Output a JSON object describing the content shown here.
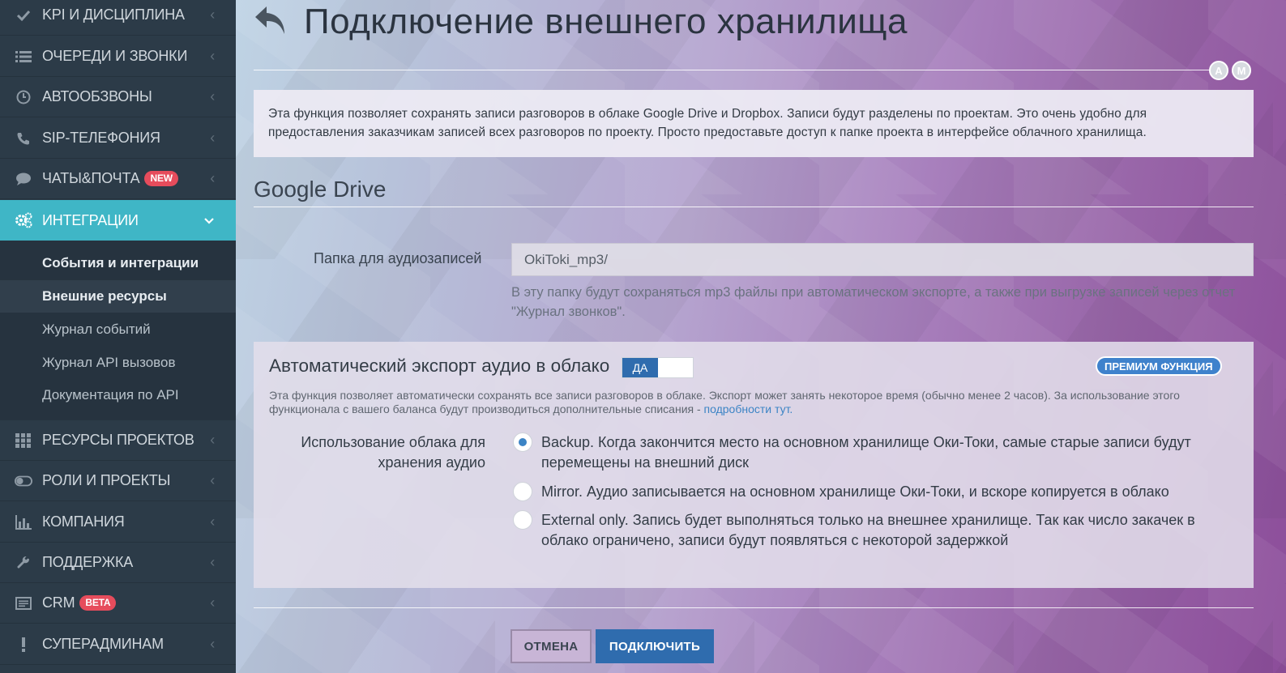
{
  "sidebar": {
    "items": [
      {
        "label": "KPI И ДИСЦИПЛИНА",
        "icon": "check-icon"
      },
      {
        "label": "ОЧЕРЕДИ И ЗВОНКИ",
        "icon": "list-icon"
      },
      {
        "label": "АВТООБЗВОНЫ",
        "icon": "clock-icon"
      },
      {
        "label": "SIP-ТЕЛЕФОНИЯ",
        "icon": "phone-icon"
      },
      {
        "label": "ЧАТЫ&ПОЧТА",
        "icon": "chat-icon",
        "badge": "NEW"
      },
      {
        "label": "ИНТЕГРАЦИИ",
        "icon": "gears-icon"
      },
      {
        "label": "РЕСУРСЫ ПРОЕКТОВ",
        "icon": "grid-icon"
      },
      {
        "label": "РОЛИ И ПРОЕКТЫ",
        "icon": "toggle-icon"
      },
      {
        "label": "КОМПАНИЯ",
        "icon": "bar-chart-icon"
      },
      {
        "label": "ПОДДЕРЖКА",
        "icon": "wrench-icon"
      },
      {
        "label": "CRM",
        "icon": "card-icon",
        "badge": "BETA"
      },
      {
        "label": "СУПЕРАДМИНАМ",
        "icon": "exclamation-icon"
      }
    ],
    "submenu": [
      {
        "label": "События и интеграции"
      },
      {
        "label": "Внешние ресурсы"
      },
      {
        "label": "Журнал событий"
      },
      {
        "label": "Журнал API вызовов"
      },
      {
        "label": "Документация по API"
      }
    ]
  },
  "header": {
    "title": "Подключение внешнего хранилища",
    "lang_a": "A",
    "lang_m": "M"
  },
  "info": {
    "text": "Эта функция позволяет сохранять записи разговоров в облаке Google Drive и Dropbox. Записи будут разделены по проектам. Это очень удобно для предоставления заказчикам записей всех разговоров по проекту. Просто предоставьте доступ к папке проекта в интерфейсе облачного хранилища."
  },
  "google_drive": {
    "title": "Google Drive",
    "folder_label": "Папка для аудиозаписей",
    "folder_value": "OkiToki_mp3/",
    "folder_help": "В эту папку будут сохраняться mp3 файлы при автоматическом экспорте, а также при выгрузке записей через отчет \"Журнал звонков\"."
  },
  "auto_export": {
    "title": "Автоматический экспорт аудио в облако",
    "toggle_on": "ДА",
    "premium": "ПРЕМИУМ ФУНКЦИЯ",
    "description": "Эта функция позволяет автоматически сохранять все записи разговоров в облаке. Экспорт может занять некоторое время (обычно менее 2 часов). За использование этого функционала с вашего баланса будут производиться дополнительные списания -",
    "description_link": "подробности тут.",
    "usage_label": "Использование облака для хранения аудио",
    "options": [
      {
        "label": "Backup. Когда закончится место на основном хранилище Оки-Токи, самые старые записи будут перемещены на внешний диск",
        "selected": true
      },
      {
        "label": "Mirror. Аудио записывается на основном хранилище Оки-Токи, и вскоре копируется в облако",
        "selected": false
      },
      {
        "label": "External only. Запись будет выполняться только на внешнее хранилище. Так как число закачек в облако ограничено, записи будут появляться с некоторой задержкой",
        "selected": false
      }
    ]
  },
  "actions": {
    "cancel": "ОТМЕНА",
    "connect": "ПОДКЛЮЧИТЬ"
  },
  "colors": {
    "sidebar_bg": "#2c3b48",
    "active_item": "#3fb6c6",
    "primary_button": "#2f6cae",
    "badge_red": "#e64c5c",
    "premium_badge": "#3f82cc"
  }
}
